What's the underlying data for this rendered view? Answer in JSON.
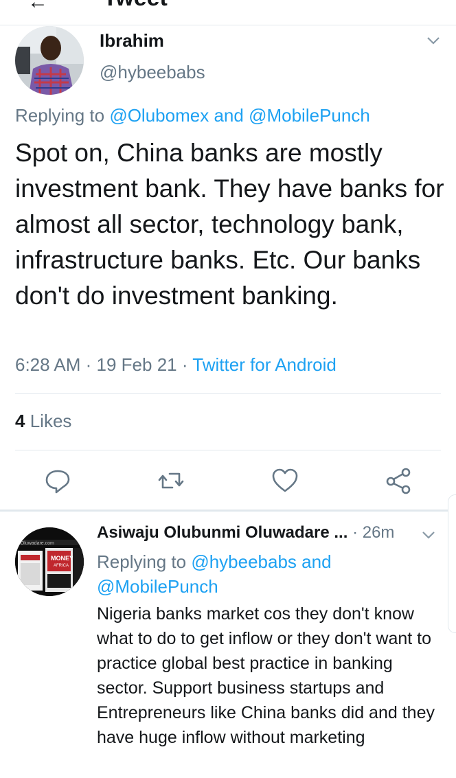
{
  "header": {
    "partial_title": "Tweet"
  },
  "tweet": {
    "author_name": "Ibrahim",
    "author_handle": "@hybeebabs",
    "replying_prefix": "Replying to",
    "replying_user1": "@Olubomex",
    "replying_and": "and",
    "replying_user2": "@MobilePunch",
    "text": "Spot on, China banks are mostly investment bank. They have banks for almost all sector, technology bank, infrastructure banks. Etc. Our banks don't do investment banking.",
    "time": "6:28 AM",
    "date": "19 Feb 21",
    "source": "Twitter for Android",
    "likes_count": "4",
    "likes_label": "Likes"
  },
  "reply": {
    "author_name": "Asiwaju Olubunmi Oluwadare ...",
    "time_ago": "26m",
    "replying_prefix": "Replying to",
    "replying_user1": "@hybeebabs",
    "replying_and": "and",
    "replying_user2": "@MobilePunch",
    "text": "Nigeria banks market cos they  don't know what to do to get inflow or they don't want to practice global best practice in banking sector. Support business startups and Entrepreneurs like China banks did and they have huge inflow without marketing"
  },
  "avatar_book": {
    "site": "mOluwadare.com",
    "title1": "MONEY",
    "title2": "AFRICA"
  },
  "icons": [
    "back-arrow-icon",
    "chevron-down-icon",
    "reply-icon",
    "retweet-icon",
    "like-icon",
    "share-icon"
  ],
  "colors": {
    "link": "#1da1f2",
    "secondary_text": "#657786",
    "divider": "#e1e8ed",
    "primary_text": "#14171a"
  }
}
